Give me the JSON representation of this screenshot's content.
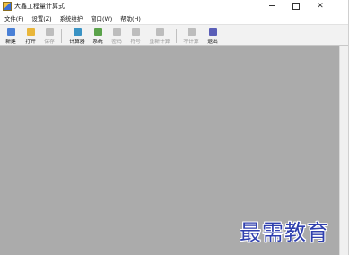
{
  "window": {
    "title": "大鑫工程量计算式",
    "controls": {
      "minimize": "−",
      "maximize": "□",
      "close": "✕"
    }
  },
  "menu": [
    {
      "label": "文件(F)"
    },
    {
      "label": "设置(Z)"
    },
    {
      "label": "系统维护"
    },
    {
      "label": "窗口(W)"
    },
    {
      "label": "帮助(H)"
    }
  ],
  "toolbar": [
    {
      "label": "新建",
      "icon": "new-file-icon",
      "color": "#4a80d6",
      "enabled": true
    },
    {
      "label": "打开",
      "icon": "open-folder-icon",
      "color": "#e9b63a",
      "enabled": true
    },
    {
      "label": "保存",
      "icon": "save-icon",
      "color": "#9e9e9e",
      "enabled": false
    },
    {
      "label": "计算器",
      "icon": "calculator-icon",
      "color": "#3a93c4",
      "enabled": true
    },
    {
      "label": "系统",
      "icon": "system-icon",
      "color": "#5aa24a",
      "enabled": true
    },
    {
      "label": "密码",
      "icon": "lock-icon",
      "color": "#9e9e9e",
      "enabled": false
    },
    {
      "label": "符号",
      "icon": "paragraph-symbol-icon",
      "color": "#9e9e9e",
      "enabled": false
    },
    {
      "label": "重新计算",
      "icon": "recalculate-icon",
      "color": "#9e9e9e",
      "enabled": false
    },
    {
      "label": "不计算",
      "icon": "no-calc-icon",
      "color": "#9e9e9e",
      "enabled": false
    },
    {
      "label": "退出",
      "icon": "exit-icon",
      "color": "#5b5fb8",
      "enabled": true
    }
  ],
  "watermark": {
    "text": "最需教育"
  }
}
